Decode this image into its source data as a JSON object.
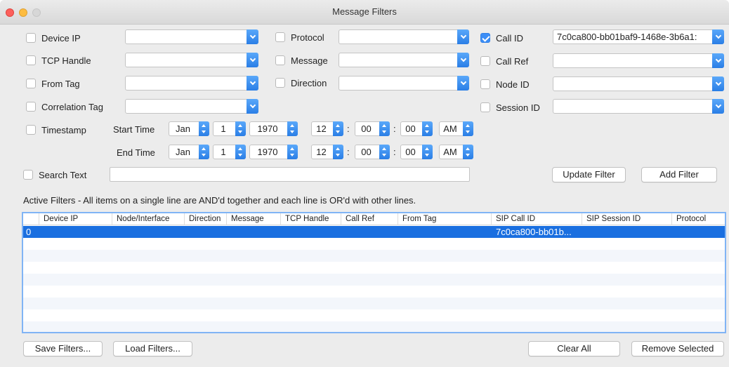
{
  "window": {
    "title": "Message Filters"
  },
  "filters": {
    "device_ip": {
      "label": "Device IP",
      "checked": false,
      "value": ""
    },
    "tcp_handle": {
      "label": "TCP Handle",
      "checked": false,
      "value": ""
    },
    "from_tag": {
      "label": "From Tag",
      "checked": false,
      "value": ""
    },
    "correlation_tag": {
      "label": "Correlation Tag",
      "checked": false,
      "value": ""
    },
    "protocol": {
      "label": "Protocol",
      "checked": false,
      "value": ""
    },
    "message": {
      "label": "Message",
      "checked": false,
      "value": ""
    },
    "direction": {
      "label": "Direction",
      "checked": false,
      "value": ""
    },
    "call_id": {
      "label": "Call ID",
      "checked": true,
      "value": "7c0ca800-bb01baf9-1468e-3b6a1:"
    },
    "call_ref": {
      "label": "Call Ref",
      "checked": false,
      "value": ""
    },
    "node_id": {
      "label": "Node ID",
      "checked": false,
      "value": ""
    },
    "session_id": {
      "label": "Session ID",
      "checked": false,
      "value": ""
    },
    "timestamp": {
      "label": "Timestamp",
      "checked": false
    },
    "search_text": {
      "label": "Search Text",
      "checked": false,
      "value": ""
    }
  },
  "time": {
    "start_label": "Start Time",
    "end_label": "End Time",
    "start": {
      "month": "Jan",
      "day": "1",
      "year": "1970",
      "hour": "12",
      "minute": "00",
      "second": "00",
      "ampm": "AM"
    },
    "end": {
      "month": "Jan",
      "day": "1",
      "year": "1970",
      "hour": "12",
      "minute": "00",
      "second": "00",
      "ampm": "AM"
    },
    "sep": ":"
  },
  "buttons": {
    "update_filter": "Update Filter",
    "add_filter": "Add Filter",
    "save_filters": "Save Filters...",
    "load_filters": "Load Filters...",
    "clear_all": "Clear All",
    "remove_selected": "Remove Selected"
  },
  "active_filters": {
    "description": "Active Filters - All items on a single line are AND'd together and each line is OR'd with other lines.",
    "columns": [
      "Device IP",
      "Node/Interface",
      "Direction",
      "Message",
      "TCP Handle",
      "Call Ref",
      "From Tag",
      "SIP Call ID",
      "SIP Session ID",
      "Protocol"
    ],
    "rows": [
      {
        "index": "0",
        "sip_call_id": "7c0ca800-bb01b..."
      }
    ]
  },
  "colors": {
    "accent": "#1a6fe0",
    "checked": "#3c8ef6"
  }
}
